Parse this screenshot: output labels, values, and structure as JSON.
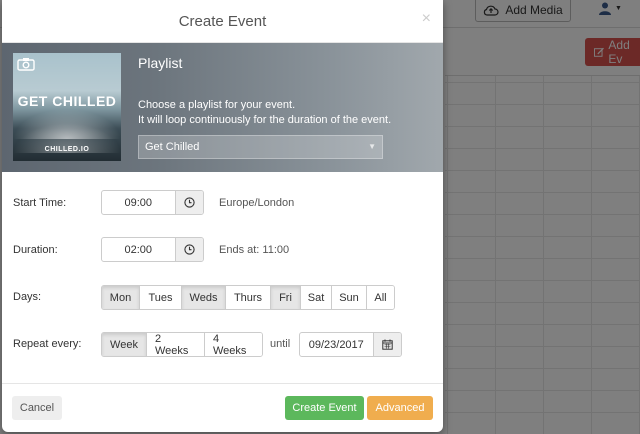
{
  "background": {
    "add_media_label": "Add Media",
    "add_event_label": "Add Ev"
  },
  "modal": {
    "title": "Create Event",
    "close_symbol": "×"
  },
  "playlist": {
    "heading": "Playlist",
    "description_line1": "Choose a playlist for your event.",
    "description_line2": "It will loop continuously for the duration of the event.",
    "selected": "Get Chilled",
    "thumbnail_title": "GET CHILLED",
    "thumbnail_brand": "CHILLED.IO"
  },
  "form": {
    "start_time_label": "Start Time:",
    "start_time_value": "09:00",
    "timezone": "Europe/London",
    "duration_label": "Duration:",
    "duration_value": "02:00",
    "ends_at": "Ends at: 11:00",
    "days_label": "Days:",
    "days": [
      {
        "label": "Mon",
        "active": true
      },
      {
        "label": "Tues",
        "active": false
      },
      {
        "label": "Weds",
        "active": true
      },
      {
        "label": "Thurs",
        "active": false
      },
      {
        "label": "Fri",
        "active": true
      },
      {
        "label": "Sat",
        "active": false
      },
      {
        "label": "Sun",
        "active": false
      },
      {
        "label": "All",
        "active": false
      }
    ],
    "repeat_label": "Repeat every:",
    "repeat_options": [
      {
        "label": "Week",
        "active": true
      },
      {
        "label": "2 Weeks",
        "active": false
      },
      {
        "label": "4 Weeks",
        "active": false
      }
    ],
    "until_label": "until",
    "until_date": "09/23/2017"
  },
  "footer": {
    "cancel_label": "Cancel",
    "create_label": "Create Event",
    "advanced_label": "Advanced"
  },
  "colors": {
    "create": "#5cb85c",
    "advanced": "#f0ad4e",
    "add_event": "#d9534f"
  }
}
